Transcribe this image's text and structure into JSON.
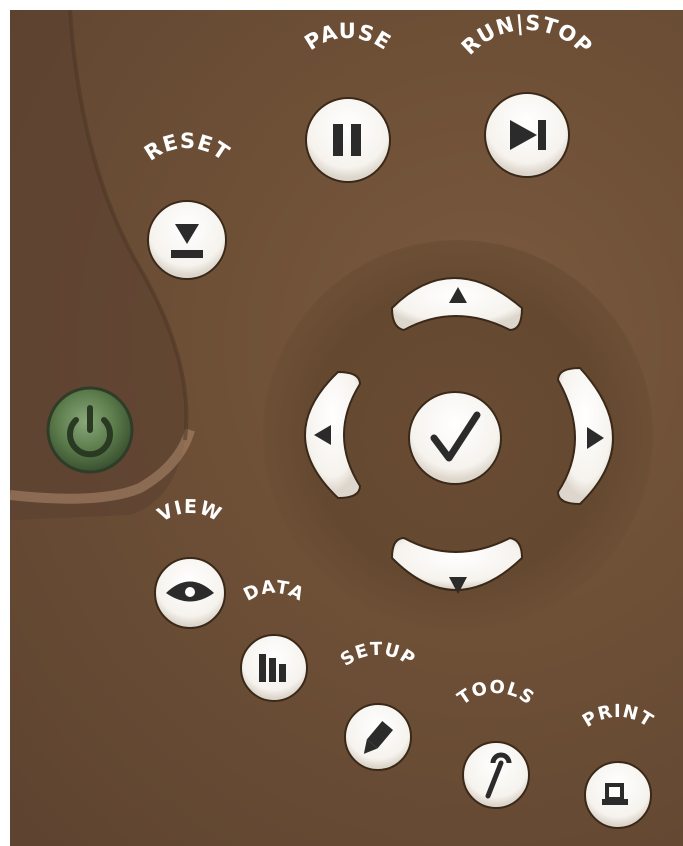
{
  "buttons": {
    "pause": "PAUSE",
    "run_stop": "RUN|STOP",
    "reset": "RESET",
    "view": "VIEW",
    "data": "DATA",
    "setup": "SETUP",
    "tools": "TOOLS",
    "print": "PRINT"
  },
  "icons": {
    "power": "power-icon",
    "pause": "pause-icon",
    "run_stop": "play-step-icon",
    "reset": "reset-icon",
    "up": "arrow-up-icon",
    "down": "arrow-down-icon",
    "left": "arrow-left-icon",
    "right": "arrow-right-icon",
    "ok": "checkmark-icon",
    "view": "eye-icon",
    "data": "bar-chart-icon",
    "setup": "pencil-icon",
    "tools": "wrench-icon",
    "print": "printer-icon"
  },
  "colors": {
    "panel": "#6d4f36",
    "button_face": "#ffffff",
    "icon": "#2b2b2b",
    "power_button": "#5a7a4a",
    "highlight": "#b08a70"
  }
}
